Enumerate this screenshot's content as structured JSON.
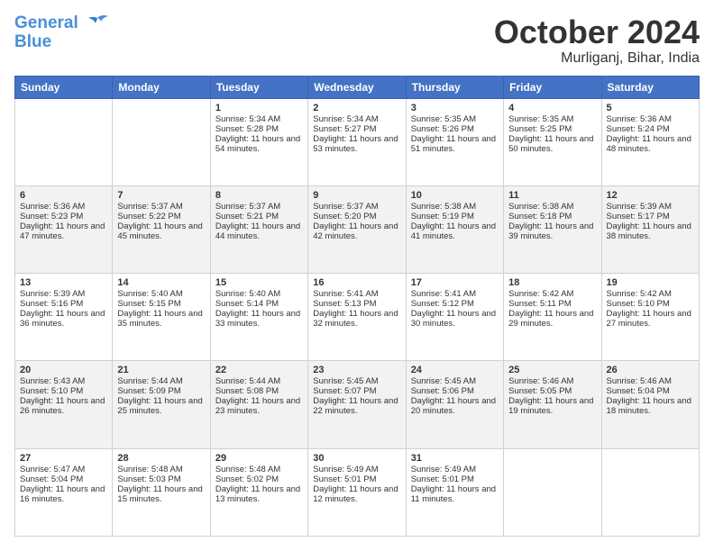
{
  "header": {
    "logo_line1": "General",
    "logo_line2": "Blue",
    "month": "October 2024",
    "location": "Murliganj, Bihar, India"
  },
  "weekdays": [
    "Sunday",
    "Monday",
    "Tuesday",
    "Wednesday",
    "Thursday",
    "Friday",
    "Saturday"
  ],
  "weeks": [
    [
      {
        "day": "",
        "sunrise": "",
        "sunset": "",
        "daylight": ""
      },
      {
        "day": "",
        "sunrise": "",
        "sunset": "",
        "daylight": ""
      },
      {
        "day": "1",
        "sunrise": "Sunrise: 5:34 AM",
        "sunset": "Sunset: 5:28 PM",
        "daylight": "Daylight: 11 hours and 54 minutes."
      },
      {
        "day": "2",
        "sunrise": "Sunrise: 5:34 AM",
        "sunset": "Sunset: 5:27 PM",
        "daylight": "Daylight: 11 hours and 53 minutes."
      },
      {
        "day": "3",
        "sunrise": "Sunrise: 5:35 AM",
        "sunset": "Sunset: 5:26 PM",
        "daylight": "Daylight: 11 hours and 51 minutes."
      },
      {
        "day": "4",
        "sunrise": "Sunrise: 5:35 AM",
        "sunset": "Sunset: 5:25 PM",
        "daylight": "Daylight: 11 hours and 50 minutes."
      },
      {
        "day": "5",
        "sunrise": "Sunrise: 5:36 AM",
        "sunset": "Sunset: 5:24 PM",
        "daylight": "Daylight: 11 hours and 48 minutes."
      }
    ],
    [
      {
        "day": "6",
        "sunrise": "Sunrise: 5:36 AM",
        "sunset": "Sunset: 5:23 PM",
        "daylight": "Daylight: 11 hours and 47 minutes."
      },
      {
        "day": "7",
        "sunrise": "Sunrise: 5:37 AM",
        "sunset": "Sunset: 5:22 PM",
        "daylight": "Daylight: 11 hours and 45 minutes."
      },
      {
        "day": "8",
        "sunrise": "Sunrise: 5:37 AM",
        "sunset": "Sunset: 5:21 PM",
        "daylight": "Daylight: 11 hours and 44 minutes."
      },
      {
        "day": "9",
        "sunrise": "Sunrise: 5:37 AM",
        "sunset": "Sunset: 5:20 PM",
        "daylight": "Daylight: 11 hours and 42 minutes."
      },
      {
        "day": "10",
        "sunrise": "Sunrise: 5:38 AM",
        "sunset": "Sunset: 5:19 PM",
        "daylight": "Daylight: 11 hours and 41 minutes."
      },
      {
        "day": "11",
        "sunrise": "Sunrise: 5:38 AM",
        "sunset": "Sunset: 5:18 PM",
        "daylight": "Daylight: 11 hours and 39 minutes."
      },
      {
        "day": "12",
        "sunrise": "Sunrise: 5:39 AM",
        "sunset": "Sunset: 5:17 PM",
        "daylight": "Daylight: 11 hours and 38 minutes."
      }
    ],
    [
      {
        "day": "13",
        "sunrise": "Sunrise: 5:39 AM",
        "sunset": "Sunset: 5:16 PM",
        "daylight": "Daylight: 11 hours and 36 minutes."
      },
      {
        "day": "14",
        "sunrise": "Sunrise: 5:40 AM",
        "sunset": "Sunset: 5:15 PM",
        "daylight": "Daylight: 11 hours and 35 minutes."
      },
      {
        "day": "15",
        "sunrise": "Sunrise: 5:40 AM",
        "sunset": "Sunset: 5:14 PM",
        "daylight": "Daylight: 11 hours and 33 minutes."
      },
      {
        "day": "16",
        "sunrise": "Sunrise: 5:41 AM",
        "sunset": "Sunset: 5:13 PM",
        "daylight": "Daylight: 11 hours and 32 minutes."
      },
      {
        "day": "17",
        "sunrise": "Sunrise: 5:41 AM",
        "sunset": "Sunset: 5:12 PM",
        "daylight": "Daylight: 11 hours and 30 minutes."
      },
      {
        "day": "18",
        "sunrise": "Sunrise: 5:42 AM",
        "sunset": "Sunset: 5:11 PM",
        "daylight": "Daylight: 11 hours and 29 minutes."
      },
      {
        "day": "19",
        "sunrise": "Sunrise: 5:42 AM",
        "sunset": "Sunset: 5:10 PM",
        "daylight": "Daylight: 11 hours and 27 minutes."
      }
    ],
    [
      {
        "day": "20",
        "sunrise": "Sunrise: 5:43 AM",
        "sunset": "Sunset: 5:10 PM",
        "daylight": "Daylight: 11 hours and 26 minutes."
      },
      {
        "day": "21",
        "sunrise": "Sunrise: 5:44 AM",
        "sunset": "Sunset: 5:09 PM",
        "daylight": "Daylight: 11 hours and 25 minutes."
      },
      {
        "day": "22",
        "sunrise": "Sunrise: 5:44 AM",
        "sunset": "Sunset: 5:08 PM",
        "daylight": "Daylight: 11 hours and 23 minutes."
      },
      {
        "day": "23",
        "sunrise": "Sunrise: 5:45 AM",
        "sunset": "Sunset: 5:07 PM",
        "daylight": "Daylight: 11 hours and 22 minutes."
      },
      {
        "day": "24",
        "sunrise": "Sunrise: 5:45 AM",
        "sunset": "Sunset: 5:06 PM",
        "daylight": "Daylight: 11 hours and 20 minutes."
      },
      {
        "day": "25",
        "sunrise": "Sunrise: 5:46 AM",
        "sunset": "Sunset: 5:05 PM",
        "daylight": "Daylight: 11 hours and 19 minutes."
      },
      {
        "day": "26",
        "sunrise": "Sunrise: 5:46 AM",
        "sunset": "Sunset: 5:04 PM",
        "daylight": "Daylight: 11 hours and 18 minutes."
      }
    ],
    [
      {
        "day": "27",
        "sunrise": "Sunrise: 5:47 AM",
        "sunset": "Sunset: 5:04 PM",
        "daylight": "Daylight: 11 hours and 16 minutes."
      },
      {
        "day": "28",
        "sunrise": "Sunrise: 5:48 AM",
        "sunset": "Sunset: 5:03 PM",
        "daylight": "Daylight: 11 hours and 15 minutes."
      },
      {
        "day": "29",
        "sunrise": "Sunrise: 5:48 AM",
        "sunset": "Sunset: 5:02 PM",
        "daylight": "Daylight: 11 hours and 13 minutes."
      },
      {
        "day": "30",
        "sunrise": "Sunrise: 5:49 AM",
        "sunset": "Sunset: 5:01 PM",
        "daylight": "Daylight: 11 hours and 12 minutes."
      },
      {
        "day": "31",
        "sunrise": "Sunrise: 5:49 AM",
        "sunset": "Sunset: 5:01 PM",
        "daylight": "Daylight: 11 hours and 11 minutes."
      },
      {
        "day": "",
        "sunrise": "",
        "sunset": "",
        "daylight": ""
      },
      {
        "day": "",
        "sunrise": "",
        "sunset": "",
        "daylight": ""
      }
    ]
  ]
}
